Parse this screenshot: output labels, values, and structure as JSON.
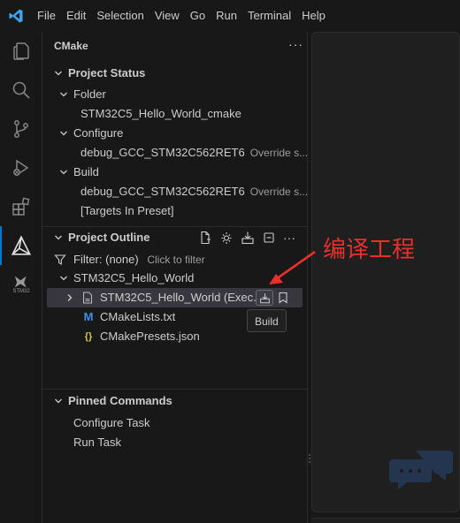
{
  "menu": {
    "items": [
      "File",
      "Edit",
      "Selection",
      "View",
      "Go",
      "Run",
      "Terminal",
      "Help"
    ]
  },
  "activity_bar": {
    "icons": [
      "explorer-icon",
      "search-icon",
      "source-control-icon",
      "run-debug-icon",
      "extensions-icon",
      "cmake-icon",
      "stm32-icon"
    ],
    "stm32_label": "STM32"
  },
  "sidebar": {
    "title": "CMake",
    "more": "···",
    "project_status": {
      "title": "Project Status",
      "folder_label": "Folder",
      "folder_value": "STM32C5_Hello_World_cmake",
      "configure_label": "Configure",
      "configure_value": "debug_GCC_STM32C562RET6",
      "configure_desc": "Override s...",
      "build_label": "Build",
      "build_value": "debug_GCC_STM32C562RET6",
      "build_desc": "Override s...",
      "targets_value": "[Targets In Preset]"
    },
    "project_outline": {
      "title": "Project Outline",
      "filter_label": "Filter: (none)",
      "filter_hint": "Click to filter",
      "project_name": "STM32C5_Hello_World",
      "target_label": "STM32C5_Hello_World (Exec...",
      "files": [
        {
          "name": "CMakeLists.txt",
          "icon": "cmake-file-icon"
        },
        {
          "name": "CMakePresets.json",
          "icon": "json-file-icon"
        }
      ]
    },
    "pinned_commands": {
      "title": "Pinned Commands",
      "items": [
        "Configure Task",
        "Run Task"
      ]
    }
  },
  "tooltip": {
    "text": "Build"
  },
  "annotation": {
    "text": "编译工程",
    "color": "#e8302a"
  },
  "colors": {
    "accent": "#0078d4",
    "selection": "#37373d",
    "annotation": "#e8302a"
  }
}
